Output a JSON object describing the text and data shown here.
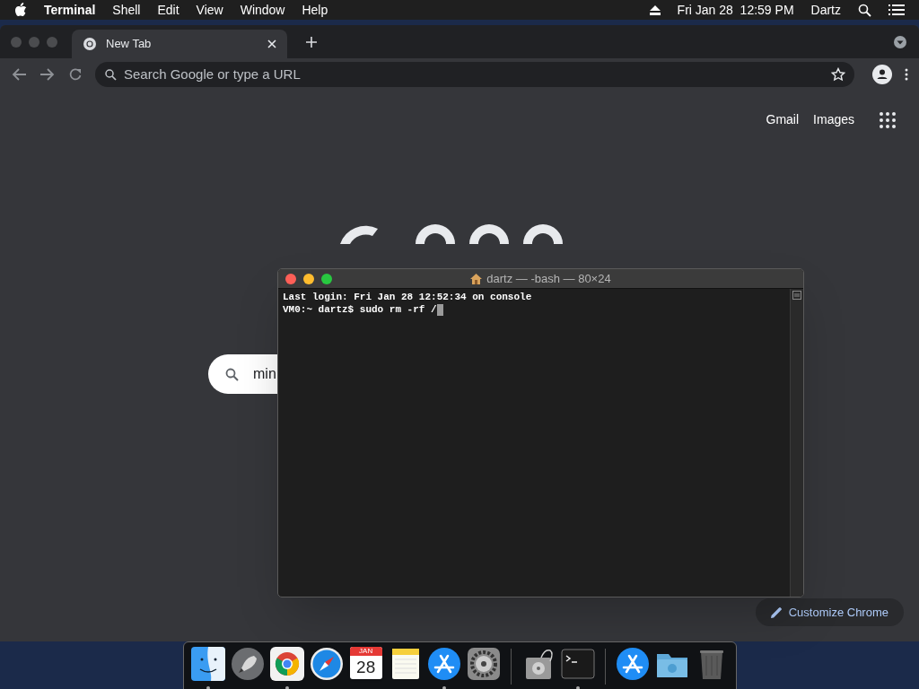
{
  "menu_bar": {
    "app": "Terminal",
    "items": [
      "Shell",
      "Edit",
      "View",
      "Window",
      "Help"
    ],
    "clock": "Fri Jan 28  12:59 PM",
    "user": "Dartz"
  },
  "browser": {
    "tabs": [
      {
        "title": "New Tab",
        "selected": true
      }
    ],
    "omnibox": {
      "placeholder": "Search Google or type a URL"
    },
    "links": [
      "Gmail",
      "Images"
    ],
    "search": {
      "value": "min"
    },
    "customize_button": "Customize Chrome"
  },
  "terminal": {
    "title": "dartz — -bash — 80×24",
    "lines": [
      "Last login: Fri Jan 28 12:52:34 on console",
      "VM0:~ dartz$ sudo rm -rf /"
    ]
  },
  "dock": {
    "items": [
      {
        "kind": "finder",
        "running": true
      },
      {
        "kind": "rocket",
        "running": false
      },
      {
        "kind": "chrome",
        "running": true
      },
      {
        "kind": "compass",
        "running": false
      },
      {
        "kind": "calendar",
        "running": false,
        "month": "JAN",
        "day": "28"
      },
      {
        "kind": "notes",
        "running": false
      },
      {
        "kind": "appstore",
        "running": true
      },
      {
        "kind": "gear",
        "running": false
      },
      {
        "kind": "separator"
      },
      {
        "kind": "disk",
        "running": false
      },
      {
        "kind": "terminal",
        "running": true
      },
      {
        "kind": "separator"
      },
      {
        "kind": "appstore",
        "running": false
      },
      {
        "kind": "folder",
        "running": false
      },
      {
        "kind": "trash",
        "running": false
      }
    ]
  }
}
